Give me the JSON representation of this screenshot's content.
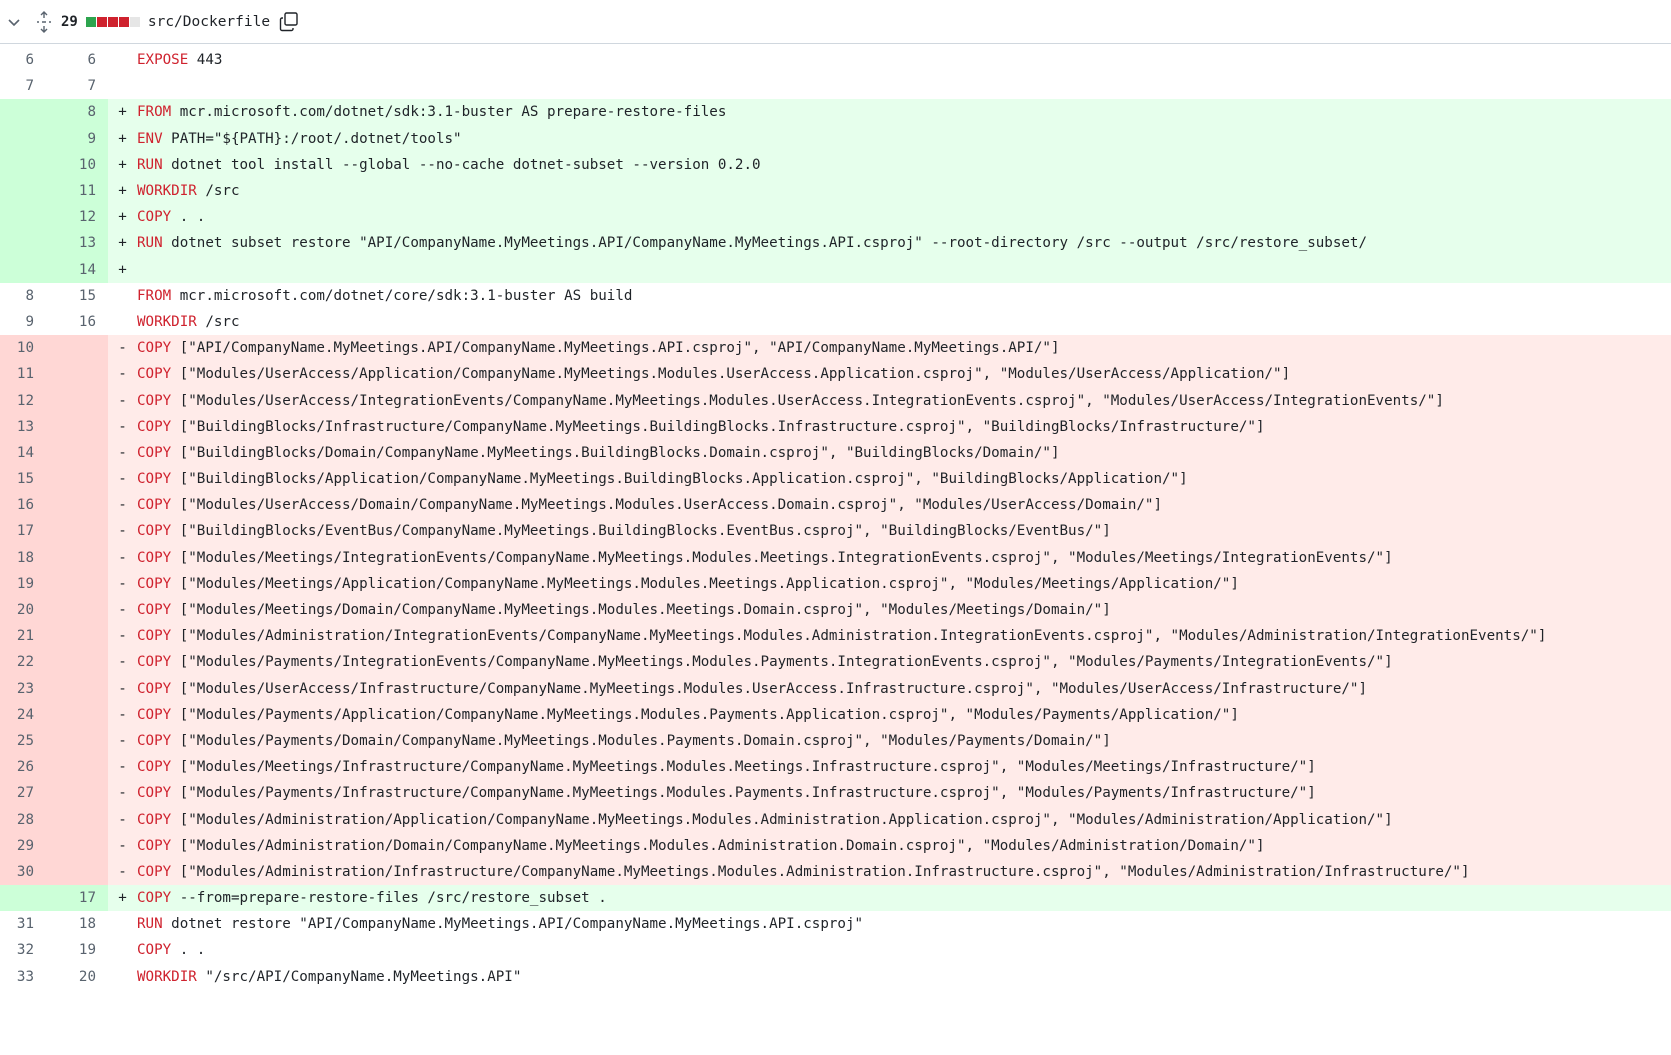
{
  "header": {
    "changes": "29",
    "path": "src/Dockerfile",
    "diffstat_colors": [
      "#2da44e",
      "#cf222e",
      "#cf222e",
      "#cf222e",
      "#e6e6e6"
    ]
  },
  "lines": [
    {
      "type": "ctx",
      "old": "6",
      "new": "6",
      "kw": "EXPOSE",
      "rest": " 443"
    },
    {
      "type": "ctx",
      "old": "7",
      "new": "7",
      "kw": "",
      "rest": ""
    },
    {
      "type": "add",
      "old": "",
      "new": "8",
      "kw": "FROM",
      "rest": " mcr.microsoft.com/dotnet/sdk:3.1-buster AS prepare-restore-files"
    },
    {
      "type": "add",
      "old": "",
      "new": "9",
      "kw": "ENV",
      "rest": " PATH=\"${PATH}:/root/.dotnet/tools\""
    },
    {
      "type": "add",
      "old": "",
      "new": "10",
      "kw": "RUN",
      "rest": " dotnet tool install --global --no-cache dotnet-subset --version 0.2.0"
    },
    {
      "type": "add",
      "old": "",
      "new": "11",
      "kw": "WORKDIR",
      "rest": " /src"
    },
    {
      "type": "add",
      "old": "",
      "new": "12",
      "kw": "COPY",
      "rest": " . ."
    },
    {
      "type": "add",
      "old": "",
      "new": "13",
      "kw": "RUN",
      "rest": " dotnet subset restore \"API/CompanyName.MyMeetings.API/CompanyName.MyMeetings.API.csproj\" --root-directory /src --output /src/restore_subset/"
    },
    {
      "type": "add",
      "old": "",
      "new": "14",
      "kw": "",
      "rest": ""
    },
    {
      "type": "ctx",
      "old": "8",
      "new": "15",
      "kw": "FROM",
      "rest": " mcr.microsoft.com/dotnet/core/sdk:3.1-buster AS build"
    },
    {
      "type": "ctx",
      "old": "9",
      "new": "16",
      "kw": "WORKDIR",
      "rest": " /src"
    },
    {
      "type": "del",
      "old": "10",
      "new": "",
      "kw": "COPY",
      "rest": " [\"API/CompanyName.MyMeetings.API/CompanyName.MyMeetings.API.csproj\", \"API/CompanyName.MyMeetings.API/\"]"
    },
    {
      "type": "del",
      "old": "11",
      "new": "",
      "kw": "COPY",
      "rest": " [\"Modules/UserAccess/Application/CompanyName.MyMeetings.Modules.UserAccess.Application.csproj\", \"Modules/UserAccess/Application/\"]"
    },
    {
      "type": "del",
      "old": "12",
      "new": "",
      "kw": "COPY",
      "rest": " [\"Modules/UserAccess/IntegrationEvents/CompanyName.MyMeetings.Modules.UserAccess.IntegrationEvents.csproj\", \"Modules/UserAccess/IntegrationEvents/\"]"
    },
    {
      "type": "del",
      "old": "13",
      "new": "",
      "kw": "COPY",
      "rest": " [\"BuildingBlocks/Infrastructure/CompanyName.MyMeetings.BuildingBlocks.Infrastructure.csproj\", \"BuildingBlocks/Infrastructure/\"]"
    },
    {
      "type": "del",
      "old": "14",
      "new": "",
      "kw": "COPY",
      "rest": " [\"BuildingBlocks/Domain/CompanyName.MyMeetings.BuildingBlocks.Domain.csproj\", \"BuildingBlocks/Domain/\"]"
    },
    {
      "type": "del",
      "old": "15",
      "new": "",
      "kw": "COPY",
      "rest": " [\"BuildingBlocks/Application/CompanyName.MyMeetings.BuildingBlocks.Application.csproj\", \"BuildingBlocks/Application/\"]"
    },
    {
      "type": "del",
      "old": "16",
      "new": "",
      "kw": "COPY",
      "rest": " [\"Modules/UserAccess/Domain/CompanyName.MyMeetings.Modules.UserAccess.Domain.csproj\", \"Modules/UserAccess/Domain/\"]"
    },
    {
      "type": "del",
      "old": "17",
      "new": "",
      "kw": "COPY",
      "rest": " [\"BuildingBlocks/EventBus/CompanyName.MyMeetings.BuildingBlocks.EventBus.csproj\", \"BuildingBlocks/EventBus/\"]"
    },
    {
      "type": "del",
      "old": "18",
      "new": "",
      "kw": "COPY",
      "rest": " [\"Modules/Meetings/IntegrationEvents/CompanyName.MyMeetings.Modules.Meetings.IntegrationEvents.csproj\", \"Modules/Meetings/IntegrationEvents/\"]"
    },
    {
      "type": "del",
      "old": "19",
      "new": "",
      "kw": "COPY",
      "rest": " [\"Modules/Meetings/Application/CompanyName.MyMeetings.Modules.Meetings.Application.csproj\", \"Modules/Meetings/Application/\"]"
    },
    {
      "type": "del",
      "old": "20",
      "new": "",
      "kw": "COPY",
      "rest": " [\"Modules/Meetings/Domain/CompanyName.MyMeetings.Modules.Meetings.Domain.csproj\", \"Modules/Meetings/Domain/\"]"
    },
    {
      "type": "del",
      "old": "21",
      "new": "",
      "kw": "COPY",
      "rest": " [\"Modules/Administration/IntegrationEvents/CompanyName.MyMeetings.Modules.Administration.IntegrationEvents.csproj\", \"Modules/Administration/IntegrationEvents/\"]"
    },
    {
      "type": "del",
      "old": "22",
      "new": "",
      "kw": "COPY",
      "rest": " [\"Modules/Payments/IntegrationEvents/CompanyName.MyMeetings.Modules.Payments.IntegrationEvents.csproj\", \"Modules/Payments/IntegrationEvents/\"]"
    },
    {
      "type": "del",
      "old": "23",
      "new": "",
      "kw": "COPY",
      "rest": " [\"Modules/UserAccess/Infrastructure/CompanyName.MyMeetings.Modules.UserAccess.Infrastructure.csproj\", \"Modules/UserAccess/Infrastructure/\"]"
    },
    {
      "type": "del",
      "old": "24",
      "new": "",
      "kw": "COPY",
      "rest": " [\"Modules/Payments/Application/CompanyName.MyMeetings.Modules.Payments.Application.csproj\", \"Modules/Payments/Application/\"]"
    },
    {
      "type": "del",
      "old": "25",
      "new": "",
      "kw": "COPY",
      "rest": " [\"Modules/Payments/Domain/CompanyName.MyMeetings.Modules.Payments.Domain.csproj\", \"Modules/Payments/Domain/\"]"
    },
    {
      "type": "del",
      "old": "26",
      "new": "",
      "kw": "COPY",
      "rest": " [\"Modules/Meetings/Infrastructure/CompanyName.MyMeetings.Modules.Meetings.Infrastructure.csproj\", \"Modules/Meetings/Infrastructure/\"]"
    },
    {
      "type": "del",
      "old": "27",
      "new": "",
      "kw": "COPY",
      "rest": " [\"Modules/Payments/Infrastructure/CompanyName.MyMeetings.Modules.Payments.Infrastructure.csproj\", \"Modules/Payments/Infrastructure/\"]"
    },
    {
      "type": "del",
      "old": "28",
      "new": "",
      "kw": "COPY",
      "rest": " [\"Modules/Administration/Application/CompanyName.MyMeetings.Modules.Administration.Application.csproj\", \"Modules/Administration/Application/\"]"
    },
    {
      "type": "del",
      "old": "29",
      "new": "",
      "kw": "COPY",
      "rest": " [\"Modules/Administration/Domain/CompanyName.MyMeetings.Modules.Administration.Domain.csproj\", \"Modules/Administration/Domain/\"]"
    },
    {
      "type": "del",
      "old": "30",
      "new": "",
      "kw": "COPY",
      "rest": " [\"Modules/Administration/Infrastructure/CompanyName.MyMeetings.Modules.Administration.Infrastructure.csproj\", \"Modules/Administration/Infrastructure/\"]"
    },
    {
      "type": "add",
      "old": "",
      "new": "17",
      "kw": "COPY",
      "rest": " --from=prepare-restore-files /src/restore_subset ."
    },
    {
      "type": "ctx",
      "old": "31",
      "new": "18",
      "kw": "RUN",
      "rest": " dotnet restore \"API/CompanyName.MyMeetings.API/CompanyName.MyMeetings.API.csproj\""
    },
    {
      "type": "ctx",
      "old": "32",
      "new": "19",
      "kw": "COPY",
      "rest": " . ."
    },
    {
      "type": "ctx",
      "old": "33",
      "new": "20",
      "kw": "WORKDIR",
      "rest": " \"/src/API/CompanyName.MyMeetings.API\""
    }
  ]
}
